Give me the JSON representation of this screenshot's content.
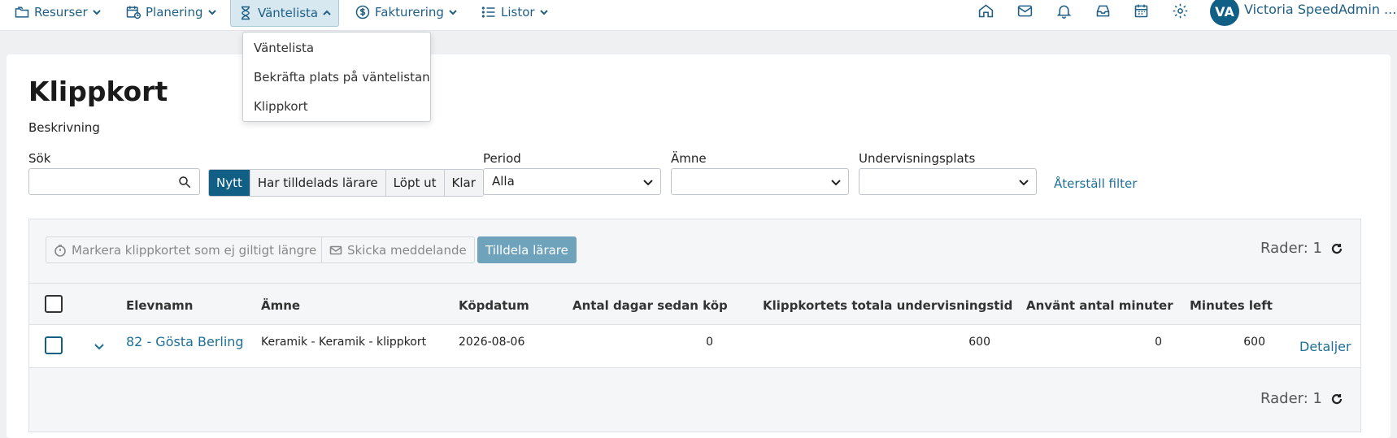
{
  "nav": {
    "items": [
      {
        "label": "Resurser",
        "icon": "folders-icon"
      },
      {
        "label": "Planering",
        "icon": "calendar-clock-icon"
      },
      {
        "label": "Väntelista",
        "icon": "hourglass-icon"
      },
      {
        "label": "Fakturering",
        "icon": "dollar-circle-icon"
      },
      {
        "label": "Listor",
        "icon": "list-icon"
      }
    ],
    "right_icons": [
      "home-icon",
      "mail-icon",
      "bell-icon",
      "inbox-icon",
      "calendar-icon",
      "gear-icon"
    ],
    "user_initials": "VA",
    "user_name": "Victoria SpeedAdmin ..."
  },
  "dropdown": {
    "items": [
      "Väntelista",
      "Bekräfta plats på väntelistan",
      "Klippkort"
    ]
  },
  "page": {
    "title": "Klippkort",
    "description": "Beskrivning"
  },
  "filters": {
    "search_label": "Sök",
    "search_value": "",
    "status_buttons": [
      "Nytt",
      "Har tilldelads lärare",
      "Löpt ut",
      "Klar"
    ],
    "active_status": "Nytt",
    "period_label": "Period",
    "period_value": "Alla",
    "subject_label": "Ämne",
    "subject_value": "",
    "location_label": "Undervisningsplats",
    "location_value": "",
    "reset_label": "Återställ filter"
  },
  "toolbar": {
    "mark_invalid": "Markera klippkortet som ej giltigt längre",
    "send_message": "Skicka meddelande",
    "assign_teacher": "Tilldela lärare",
    "rows_top": "Rader: 1",
    "rows_bottom": "Rader: 1"
  },
  "table": {
    "columns": [
      "Elevnamn",
      "Ämne",
      "Köpdatum",
      "Antal dagar sedan köp",
      "Klippkortets totala undervisningstid",
      "Använt antal minuter",
      "Minutes left"
    ],
    "rows": [
      {
        "student": "82 - Gösta Berling",
        "subject": "Keramik - Keramik - klippkort",
        "purchase_date": "2026-08-06",
        "days_since": "0",
        "total_time": "600",
        "used_minutes": "0",
        "minutes_left": "600",
        "details": "Detaljer"
      }
    ]
  },
  "colors": {
    "primary": "#125f86",
    "link": "#1f6f96",
    "accent_light": "#6fa3bb"
  }
}
